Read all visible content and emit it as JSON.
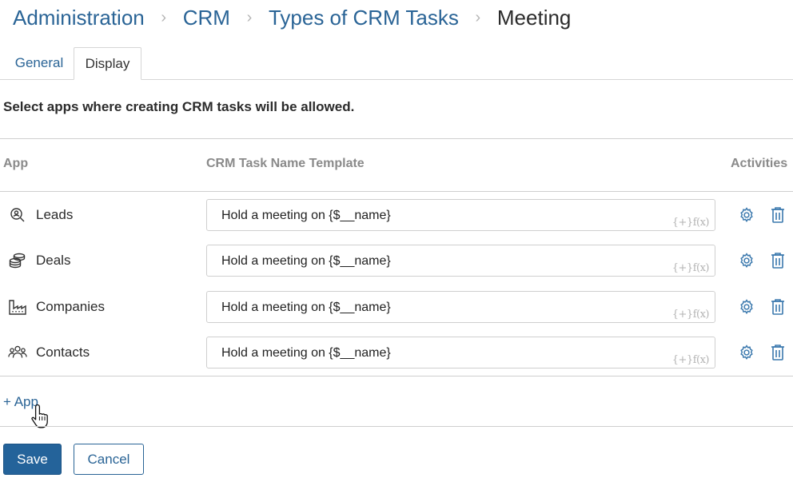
{
  "breadcrumb": {
    "items": [
      "Administration",
      "CRM",
      "Types of CRM Tasks"
    ],
    "current": "Meeting",
    "separator": "›"
  },
  "tabs": [
    {
      "label": "General",
      "active": false
    },
    {
      "label": "Display",
      "active": true
    }
  ],
  "description": "Select apps where creating CRM tasks will be allowed.",
  "table": {
    "headers": {
      "app": "App",
      "template": "CRM Task Name Template",
      "activities": "Activities"
    },
    "rows": [
      {
        "app": "Leads",
        "icon": "leads-search-icon",
        "template": "Hold a meeting on {$__name}"
      },
      {
        "app": "Deals",
        "icon": "deals-coins-icon",
        "template": "Hold a meeting on {$__name}"
      },
      {
        "app": "Companies",
        "icon": "companies-factory-icon",
        "template": "Hold a meeting on {$__name}"
      },
      {
        "app": "Contacts",
        "icon": "contacts-people-icon",
        "template": "Hold a meeting on {$__name}"
      }
    ],
    "field_function_glyph": "{+}f(x)"
  },
  "add_app_label": "+ App",
  "buttons": {
    "save": "Save",
    "cancel": "Cancel"
  },
  "colors": {
    "link": "#2a6496",
    "primary": "#24639a",
    "icon": "#3a78ad",
    "muted": "#8a8a8a"
  }
}
